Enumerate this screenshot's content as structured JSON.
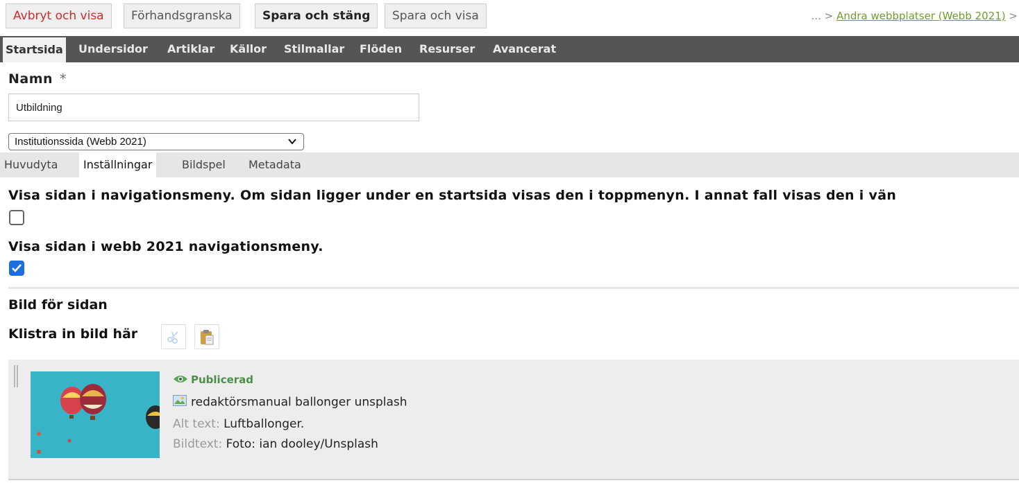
{
  "toolbar": {
    "cancel_label": "Avbryt och visa",
    "preview_label": "Förhandsgranska",
    "save_close_label": "Spara och stäng",
    "save_view_label": "Spara och visa"
  },
  "breadcrumb": {
    "prefix": "... > ",
    "link": "Andra webbplatser (Webb 2021)",
    "suffix": " >"
  },
  "main_tabs": [
    "Startsida",
    "Undersidor",
    "Artiklar",
    "Källor",
    "Stilmallar",
    "Flöden",
    "Resurser",
    "Avancerat"
  ],
  "form": {
    "name_label": "Namn",
    "required_mark": "*",
    "name_value": "Utbildning",
    "template_value": "Institutionssida (Webb 2021)"
  },
  "sub_tabs": [
    "Huvudyta",
    "Inställningar",
    "Bildspel",
    "Metadata"
  ],
  "settings": {
    "nav_menu_label": "Visa sidan i navigationsmeny. Om sidan ligger under en startsida visas den i toppmenyn. I annat fall visas den i vän",
    "nav_menu_checked": false,
    "webb2021_label": "Visa sidan i webb 2021 navigationsmeny.",
    "webb2021_checked": true
  },
  "image_section": {
    "title": "Bild för sidan",
    "paste_label": "Klistra in bild här",
    "status": "Publicerad",
    "file_name": "redaktörsmanual ballonger unsplash",
    "alt_key": "Alt text:",
    "alt_value": "Luftballonger.",
    "caption_key": "Bildtext:",
    "caption_value": "Foto: ian dooley/Unsplash"
  },
  "colors": {
    "nav_bg": "#555555",
    "accent_checked": "#1d6ce0",
    "cancel_text": "#d42a2a",
    "link": "#6e9e2f",
    "published": "#4b8f4b"
  }
}
